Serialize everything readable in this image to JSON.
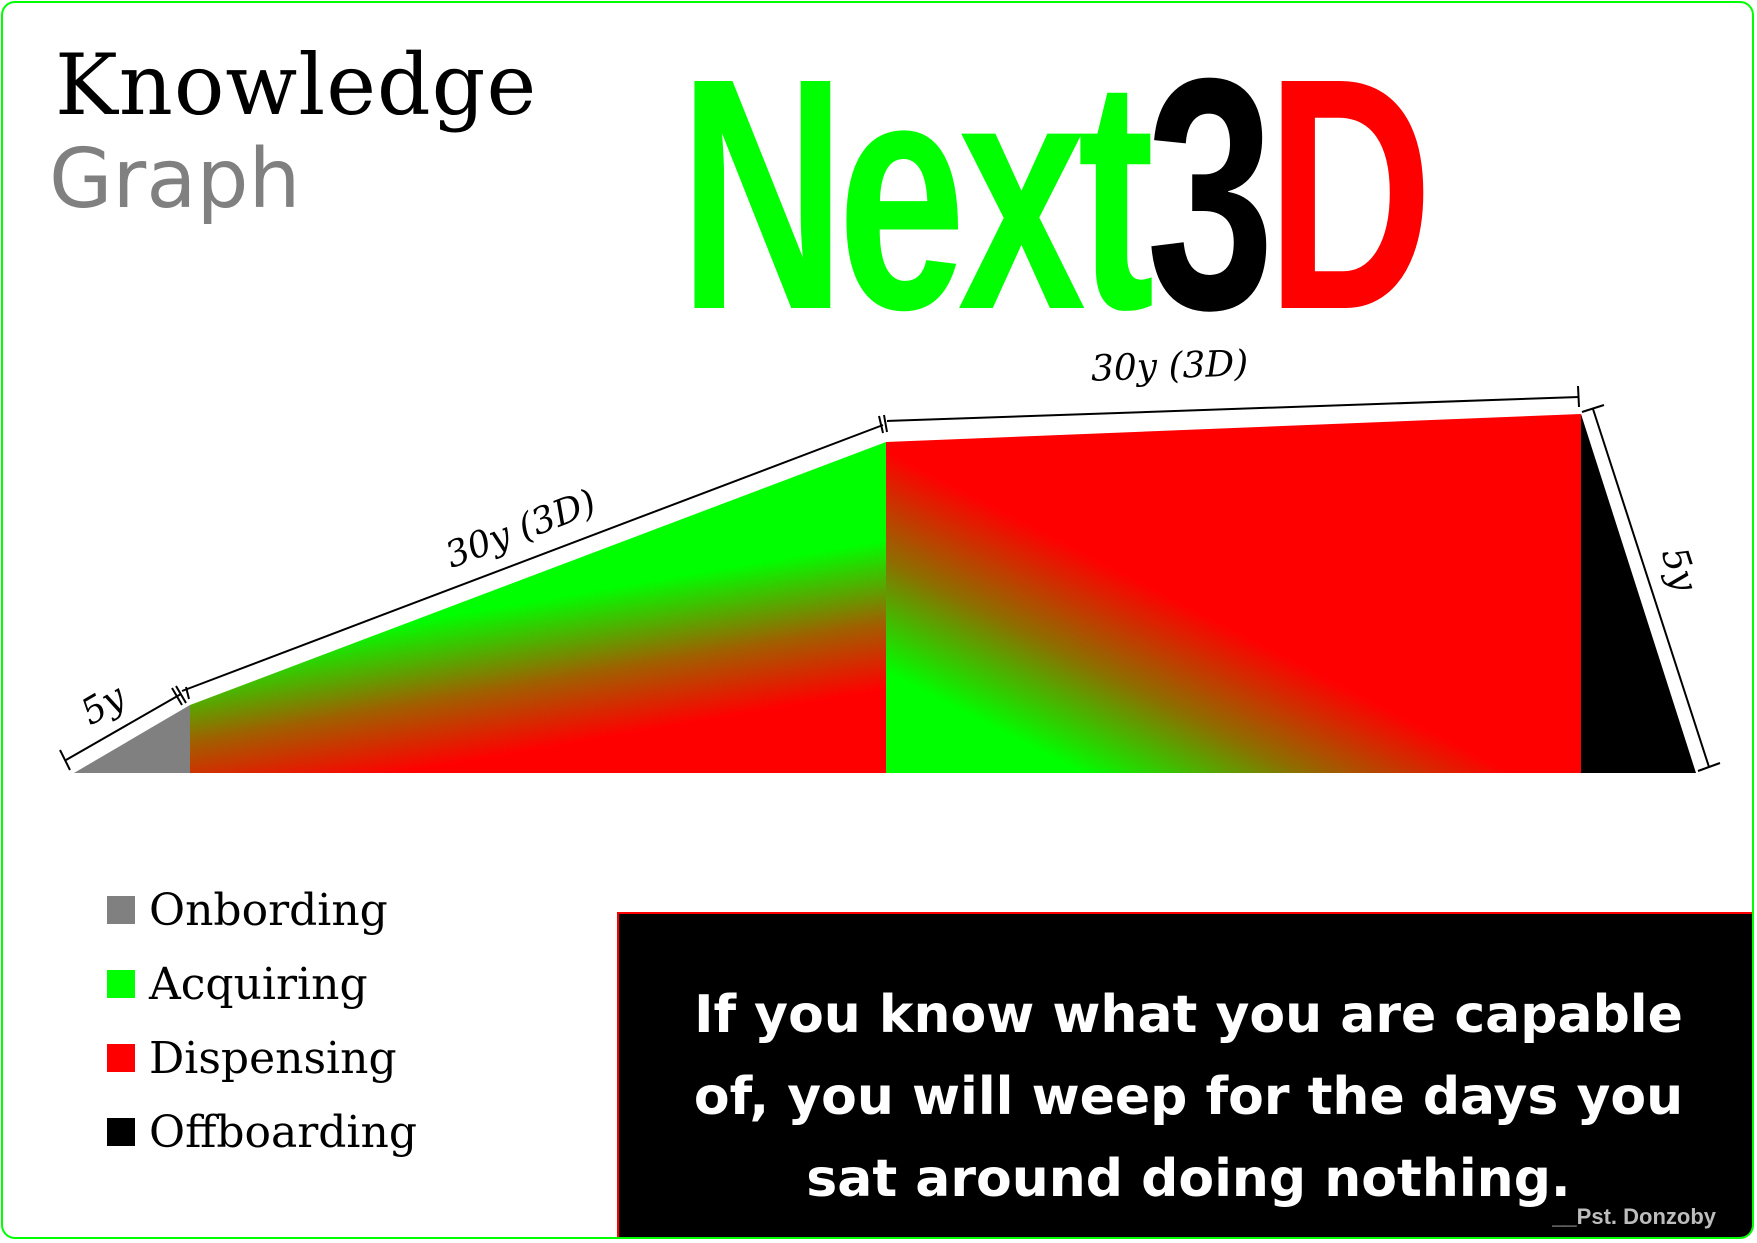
{
  "header": {
    "title": "Knowledge",
    "subtitle": "Graph",
    "brand_part1": "Next",
    "brand_part2": "3",
    "brand_part3": "D"
  },
  "colors": {
    "onboarding": "#808080",
    "acquiring": "#00ff00",
    "dispensing": "#ff0000",
    "offboarding": "#000000",
    "frame": "#00ff00"
  },
  "stages": [
    {
      "label": "5y",
      "years": 5
    },
    {
      "label": "30y (3D)",
      "years": 30
    },
    {
      "label": "30y (3D)",
      "years": 30
    },
    {
      "label": "5y",
      "years": 5
    }
  ],
  "legend": [
    {
      "label": "Onbording",
      "color": "#808080"
    },
    {
      "label": "Acquiring",
      "color": "#00ff00"
    },
    {
      "label": "Dispensing",
      "color": "#ff0000"
    },
    {
      "label": "Offboarding",
      "color": "#000000"
    }
  ],
  "quote": {
    "text": "If you know what you are capable of, you will weep for the days you sat around doing nothing.",
    "attribution": "__Pst. Donzoby"
  }
}
